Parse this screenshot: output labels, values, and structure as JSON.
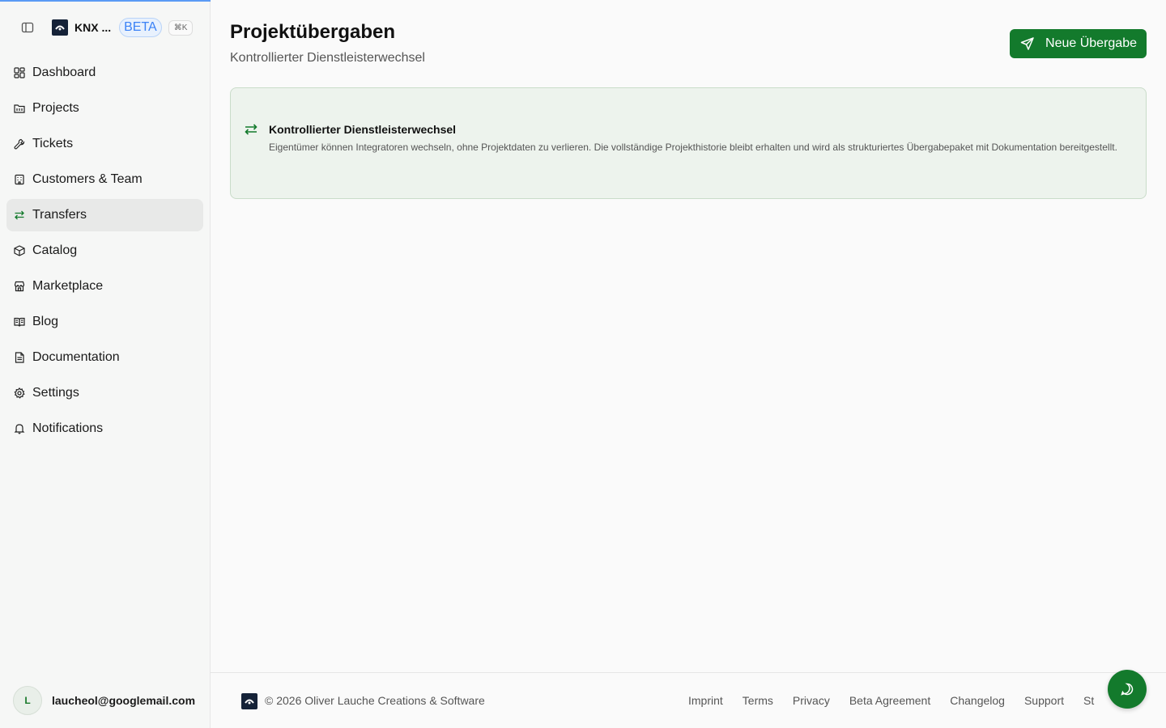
{
  "sidebar": {
    "app_name": "KNX ...",
    "beta_label": "BETA",
    "shortcut": "⌘K",
    "items": [
      {
        "label": "Dashboard",
        "icon": "dashboard-icon"
      },
      {
        "label": "Projects",
        "icon": "folder-icon"
      },
      {
        "label": "Tickets",
        "icon": "wrench-icon"
      },
      {
        "label": "Customers & Team",
        "icon": "building-icon"
      },
      {
        "label": "Transfers",
        "icon": "transfer-icon",
        "active": true
      },
      {
        "label": "Catalog",
        "icon": "package-icon"
      },
      {
        "label": "Marketplace",
        "icon": "store-icon"
      },
      {
        "label": "Blog",
        "icon": "book-icon"
      },
      {
        "label": "Documentation",
        "icon": "document-icon"
      },
      {
        "label": "Settings",
        "icon": "gear-icon"
      },
      {
        "label": "Notifications",
        "icon": "bell-icon"
      }
    ],
    "user": {
      "initial": "L",
      "email": "laucheol@googlemail.com"
    }
  },
  "header": {
    "title": "Projektübergaben",
    "subtitle": "Kontrollierter Dienstleisterwechsel",
    "new_button": "Neue Übergabe"
  },
  "info_card": {
    "title": "Kontrollierter Dienstleisterwechsel",
    "body": "Eigentümer können Integratoren wechseln, ohne Projektdaten zu verlieren. Die vollständige Projekthistorie bleibt erhalten und wird als strukturiertes Übergabepaket mit Dokumentation bereitgestellt."
  },
  "footer": {
    "copyright": "© 2026 Oliver Lauche Creations & Software",
    "links": [
      "Imprint",
      "Terms",
      "Privacy",
      "Beta Agreement",
      "Changelog",
      "Support",
      "St"
    ]
  },
  "colors": {
    "accent": "#137a2c",
    "beta": "#3b82f6"
  }
}
